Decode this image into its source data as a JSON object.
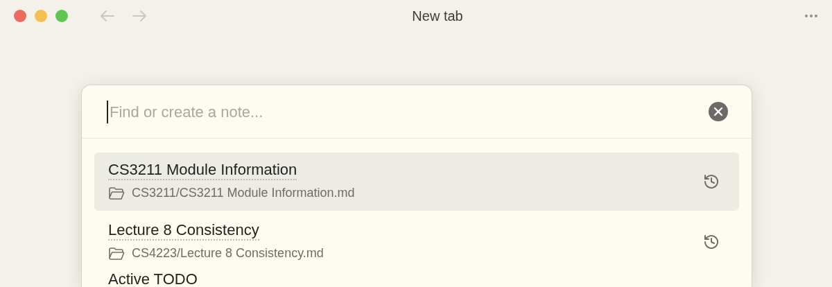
{
  "window": {
    "title": "New tab"
  },
  "search": {
    "placeholder": "Find or create a note..."
  },
  "results": [
    {
      "title": "CS3211 Module Information",
      "path": "CS3211/CS3211 Module Information.md",
      "selected": true
    },
    {
      "title": "Lecture 8 Consistency",
      "path": "CS4223/Lecture 8 Consistency.md",
      "selected": false
    },
    {
      "title": "Active TODO",
      "selected": false
    }
  ]
}
